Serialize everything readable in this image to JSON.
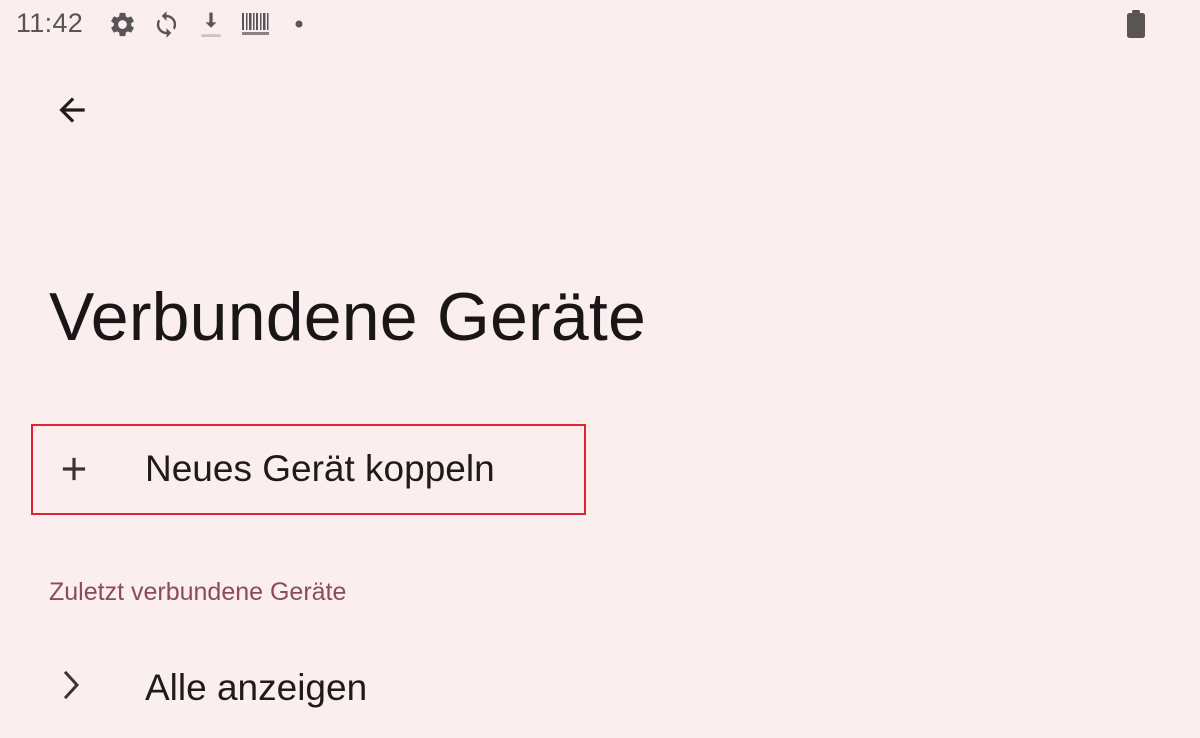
{
  "status_bar": {
    "time": "11:42",
    "icons": [
      "gear-icon",
      "sync-icon",
      "download-icon",
      "barcode-icon",
      "dot-icon",
      "battery-icon"
    ]
  },
  "header": {
    "back_icon": "arrow-left-icon"
  },
  "page": {
    "title": "Verbundene Geräte"
  },
  "pair_new_device": {
    "label": "Neues Gerät koppeln",
    "icon": "plus-icon",
    "highlight_color": "#e0242f"
  },
  "recent_devices": {
    "section_title": "Zuletzt verbundene Geräte",
    "section_color": "#8c4a60",
    "show_all_label": "Alle anzeigen",
    "show_all_icon": "chevron-right-icon"
  },
  "colors": {
    "background": "#fbeeee",
    "text_primary": "#1f1a1b",
    "status_text": "#5a5456"
  }
}
